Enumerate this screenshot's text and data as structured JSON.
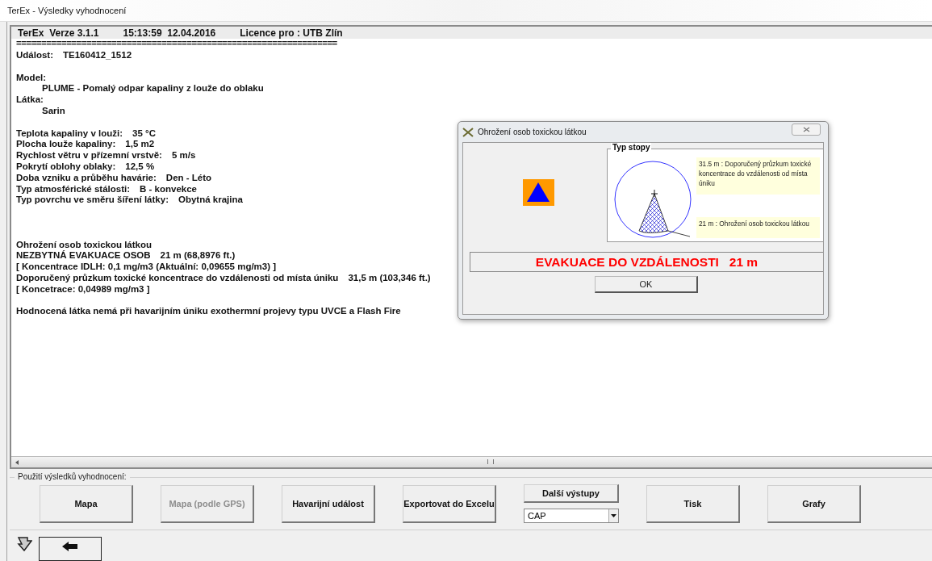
{
  "window": {
    "title": "TerEx - Výsledky vyhodnocení"
  },
  "report": {
    "header": [
      "TerEx  Verze 3.1.1",
      "15:13:59  12.04.2016",
      "Licence pro : UTB Zlín"
    ],
    "rule": "================================================================",
    "lines": [
      {
        "kind": "field",
        "label": "Událost:",
        "value": "TE160412_1512"
      },
      {
        "kind": "blank"
      },
      {
        "kind": "text",
        "text": "Model:",
        "children": [
          {
            "kind": "text",
            "text": "PLUME - Pomalý odpar kapaliny z louže do oblaku"
          }
        ]
      },
      {
        "kind": "text",
        "text": "Látka:",
        "children": [
          {
            "kind": "text",
            "text": "Sarin"
          }
        ]
      },
      {
        "kind": "blank"
      },
      {
        "kind": "field",
        "label": "Teplota kapaliny v louži:",
        "value": "35 °C"
      },
      {
        "kind": "field",
        "label": "Plocha louže kapaliny:",
        "value": "1,5 m2"
      },
      {
        "kind": "field",
        "label": "Rychlost větru v přízemní vrstvě:",
        "value": "5 m/s"
      },
      {
        "kind": "field",
        "label": "Pokrytí oblohy oblaky:",
        "value": "12,5 %"
      },
      {
        "kind": "field",
        "label": "Doba vzniku a průběhu havárie:",
        "value": "Den - Léto"
      },
      {
        "kind": "field",
        "label": "Typ atmosférické stálosti:",
        "value": "B - konvekce"
      },
      {
        "kind": "field",
        "label": "Typ povrchu ve směru šíření látky:",
        "value": "Obytná krajina"
      },
      {
        "kind": "blank"
      },
      {
        "kind": "blank"
      },
      {
        "kind": "blank"
      },
      {
        "kind": "text",
        "text": "Ohrožení osob toxickou látkou"
      },
      {
        "kind": "field",
        "label": "NEZBYTNÁ EVAKUACE OSOB",
        "value": "21 m (68,8976 ft.)"
      },
      {
        "kind": "text",
        "text": "[ Koncentrace IDLH: 0,1 mg/m3 (Aktuální: 0,09655 mg/m3) ]"
      },
      {
        "kind": "field",
        "label": "Doporučený průzkum toxické koncentrace do vzdálenosti od místa úniku",
        "value": "31,5 m (103,346 ft.)"
      },
      {
        "kind": "text",
        "text": "[ Koncetrace: 0,04989 mg/m3 ]"
      },
      {
        "kind": "blank"
      },
      {
        "kind": "text",
        "text": "Hodnocená látka nemá při havarijním úniku exothermní projevy typu UVCE a Flash Fire"
      }
    ]
  },
  "dialog": {
    "title": "Ohrožení osob toxickou látkou",
    "group_title": "Typ stopy",
    "notes": [
      "31.5 m : Doporučený průzkum toxické koncentrace do vzdálenosti od místa úniku",
      "21 m : Ohrožení osob toxickou látkou"
    ],
    "banner": "EVAKUACE DO VZDÁLENOSTI   21 m",
    "ok_button": "OK"
  },
  "usage": {
    "title": "Použití výsledků vyhodnocení:",
    "buttons": [
      {
        "kind": "button",
        "label": "Mapa",
        "disabled": false
      },
      {
        "kind": "button",
        "label": "Mapa (podle GPS)",
        "disabled": true
      },
      {
        "kind": "button",
        "label": "Havarijní událost",
        "disabled": false
      },
      {
        "kind": "button",
        "label": "Exportovat do Excelu",
        "disabled": false
      },
      {
        "kind": "dropdown",
        "label": "Další výstupy",
        "value": "CAP",
        "disabled": false
      },
      {
        "kind": "button",
        "label": "Tisk",
        "disabled": false
      },
      {
        "kind": "button",
        "label": "Grafy",
        "disabled": false
      }
    ]
  }
}
